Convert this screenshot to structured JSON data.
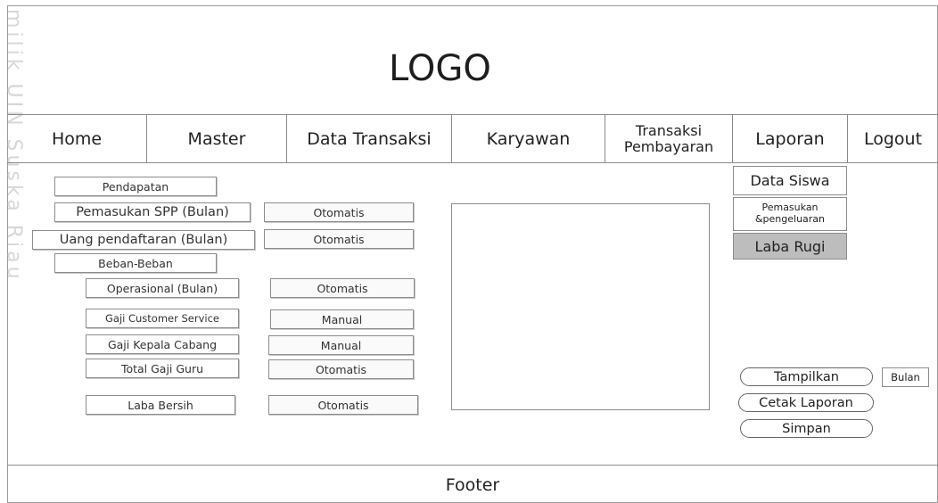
{
  "watermark": "milik UIN Suska Riau",
  "logo": "LOGO",
  "nav": [
    "Home",
    "Master",
    "Data Transaksi",
    "Karyawan",
    "Transaksi Pembayaran",
    "Laporan",
    "Logout"
  ],
  "form": {
    "pendapatan": "Pendapatan",
    "pemasukan_spp": "Pemasukan SPP (Bulan)",
    "uang_pendaftaran": "Uang pendaftaran  (Bulan)",
    "beban": "Beban-Beban",
    "operasional": "Operasional (Bulan)",
    "gaji_cs": "Gaji Customer Service",
    "gaji_kepala": "Gaji Kepala Cabang",
    "total_gaji": "Total Gaji Guru",
    "laba_bersih": "Laba Bersih",
    "values": {
      "spp": "Otomatis",
      "pendaftaran": "Otomatis",
      "operasional": "Otomatis",
      "gaji_cs": "Manual",
      "gaji_kepala": "Manual",
      "total_gaji": "Otomatis",
      "laba_bersih": "Otomatis"
    }
  },
  "dropdown": {
    "data_siswa": "Data Siswa",
    "pemasukan": "Pemasukan &pengeluaran",
    "laba_rugi": "Laba Rugi"
  },
  "buttons": {
    "tampilkan": "Tampilkan",
    "cetak": "Cetak Laporan",
    "simpan": "Simpan",
    "bulan": "Bulan"
  },
  "footer": "Footer"
}
